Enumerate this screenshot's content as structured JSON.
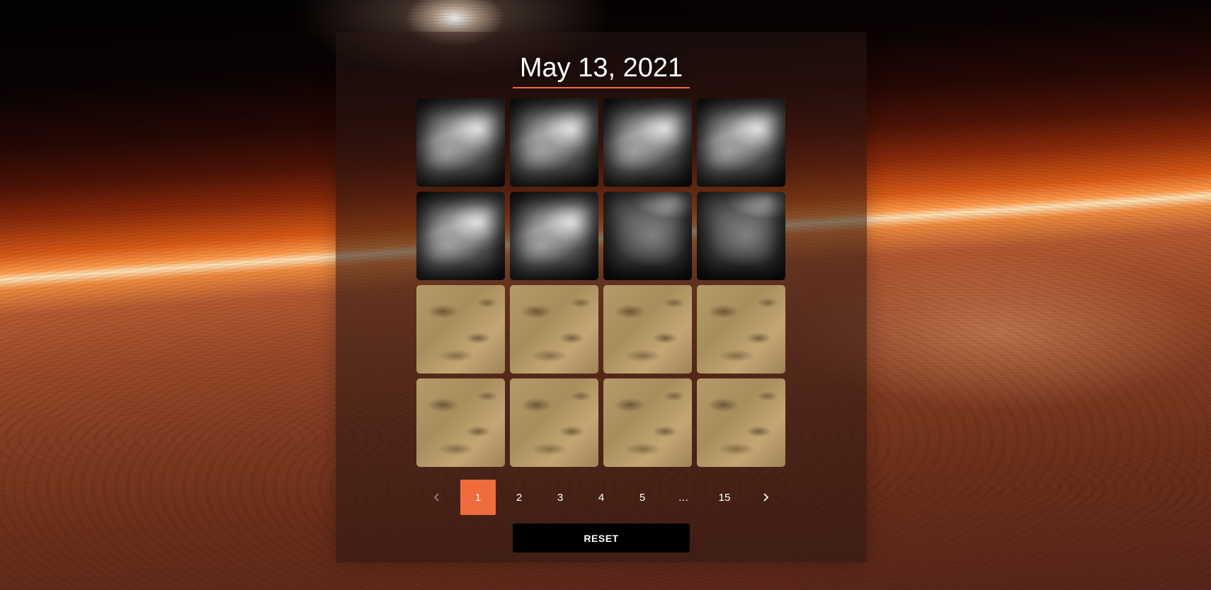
{
  "header": {
    "date_title": "May 13, 2021"
  },
  "gallery": {
    "photos": [
      {
        "kind": "grayscale-rover-camera"
      },
      {
        "kind": "grayscale-rover-camera"
      },
      {
        "kind": "grayscale-rover-camera"
      },
      {
        "kind": "grayscale-rover-camera"
      },
      {
        "kind": "grayscale-rover-camera"
      },
      {
        "kind": "grayscale-rover-camera"
      },
      {
        "kind": "grayscale-rover-camera"
      },
      {
        "kind": "grayscale-rover-camera"
      },
      {
        "kind": "color-terrain"
      },
      {
        "kind": "color-terrain"
      },
      {
        "kind": "color-terrain"
      },
      {
        "kind": "color-terrain"
      },
      {
        "kind": "color-terrain"
      },
      {
        "kind": "color-terrain"
      },
      {
        "kind": "color-terrain"
      },
      {
        "kind": "color-terrain"
      }
    ]
  },
  "pagination": {
    "prev_icon": "chevron-left-icon",
    "next_icon": "chevron-right-icon",
    "pages": [
      "1",
      "2",
      "3",
      "4",
      "5",
      "…",
      "15"
    ],
    "current": "1"
  },
  "actions": {
    "reset_label": "RESET"
  },
  "colors": {
    "accent": "#ef6c3c",
    "panel": "rgba(40,22,18,0.55)",
    "button": "#000000"
  }
}
